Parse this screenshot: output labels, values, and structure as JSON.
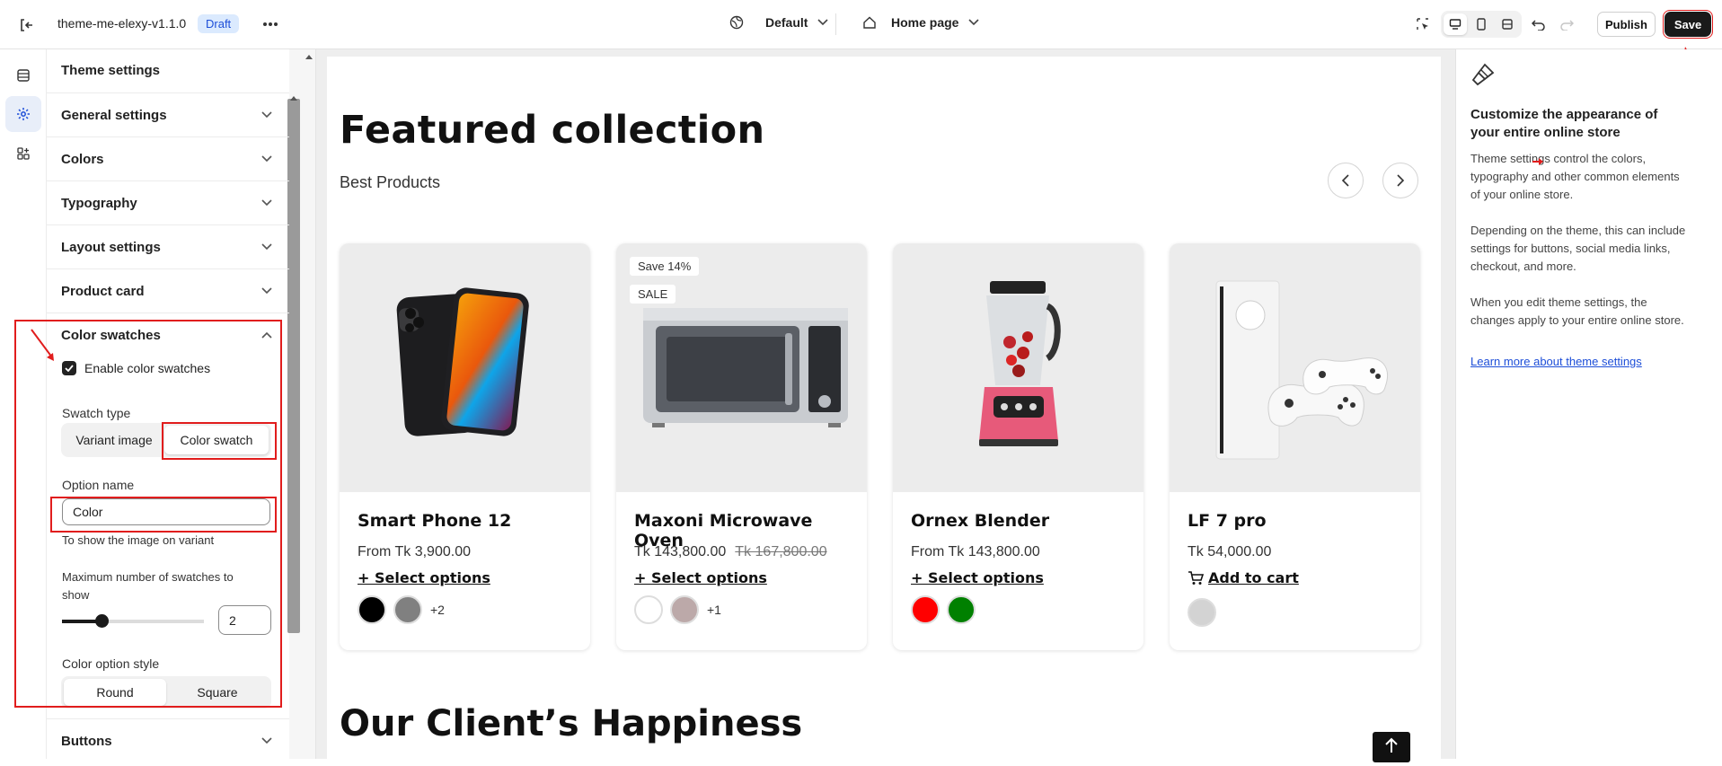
{
  "topbar": {
    "theme_name": "theme-me-elexy-v1.1.0",
    "status_badge": "Draft",
    "locale_selector": "Default",
    "page_selector": "Home page",
    "publish_label": "Publish",
    "save_label": "Save"
  },
  "sidebar": {
    "section_title": "Theme settings",
    "accordions": [
      {
        "label": "General settings"
      },
      {
        "label": "Colors"
      },
      {
        "label": "Typography"
      },
      {
        "label": "Layout settings"
      },
      {
        "label": "Product card"
      },
      {
        "label": "Color swatches"
      }
    ],
    "color_swatches": {
      "enable_label": "Enable color swatches",
      "enable_checked": true,
      "swatch_type_label": "Swatch type",
      "swatch_type_options": [
        "Variant image",
        "Color swatch"
      ],
      "swatch_type_selected": "Color swatch",
      "option_name_label": "Option name",
      "option_name_value": "Color",
      "option_name_help": "To show the image on variant",
      "max_swatches_label": "Maximum number of swatches to show",
      "max_swatches_value": "2",
      "style_label": "Color option style",
      "style_options": [
        "Round",
        "Square"
      ],
      "style_selected": "Round"
    },
    "buttons_label": "Buttons"
  },
  "preview": {
    "section_title": "Featured collection",
    "section_subtitle": "Best Products",
    "products": [
      {
        "name": "Smart Phone 12",
        "price": "From Tk 3,900.00",
        "compare_price": "",
        "action": "+ Select options",
        "swatches": [
          "#000000",
          "#808080"
        ],
        "more": "+2",
        "badges": []
      },
      {
        "name": "Maxoni Microwave Oven",
        "price": "Tk 143,800.00",
        "compare_price": "Tk 167,800.00",
        "action": "+ Select options",
        "swatches": [
          "#ffffff",
          "#bca9a9"
        ],
        "more": "+1",
        "badges": [
          "Save 14%",
          "SALE"
        ]
      },
      {
        "name": "Ornex Blender",
        "price": "From Tk 143,800.00",
        "compare_price": "",
        "action": "+ Select options",
        "swatches": [
          "#ff0000",
          "#008000"
        ],
        "more": "",
        "badges": []
      },
      {
        "name": "LF 7 pro",
        "price": "Tk 54,000.00",
        "compare_price": "",
        "action": "Add to cart",
        "swatches": [
          "#d3d3d3"
        ],
        "more": "",
        "badges": []
      }
    ],
    "next_section_title": "Our Client’s Happiness"
  },
  "info_panel": {
    "title": "Customize the appearance of your entire online store",
    "paragraphs": [
      "Theme settings control the colors, typography and other common elements of your online store.",
      "Depending on the theme, this can include settings for buttons, social media links, checkout, and more.",
      "When you edit theme settings, the changes apply to your entire online store."
    ],
    "link": "Learn more about theme settings"
  },
  "colors": {
    "accent": "#1d4ed8",
    "annotation_red": "#e11d1d",
    "save_bg": "#1a1a1a"
  }
}
